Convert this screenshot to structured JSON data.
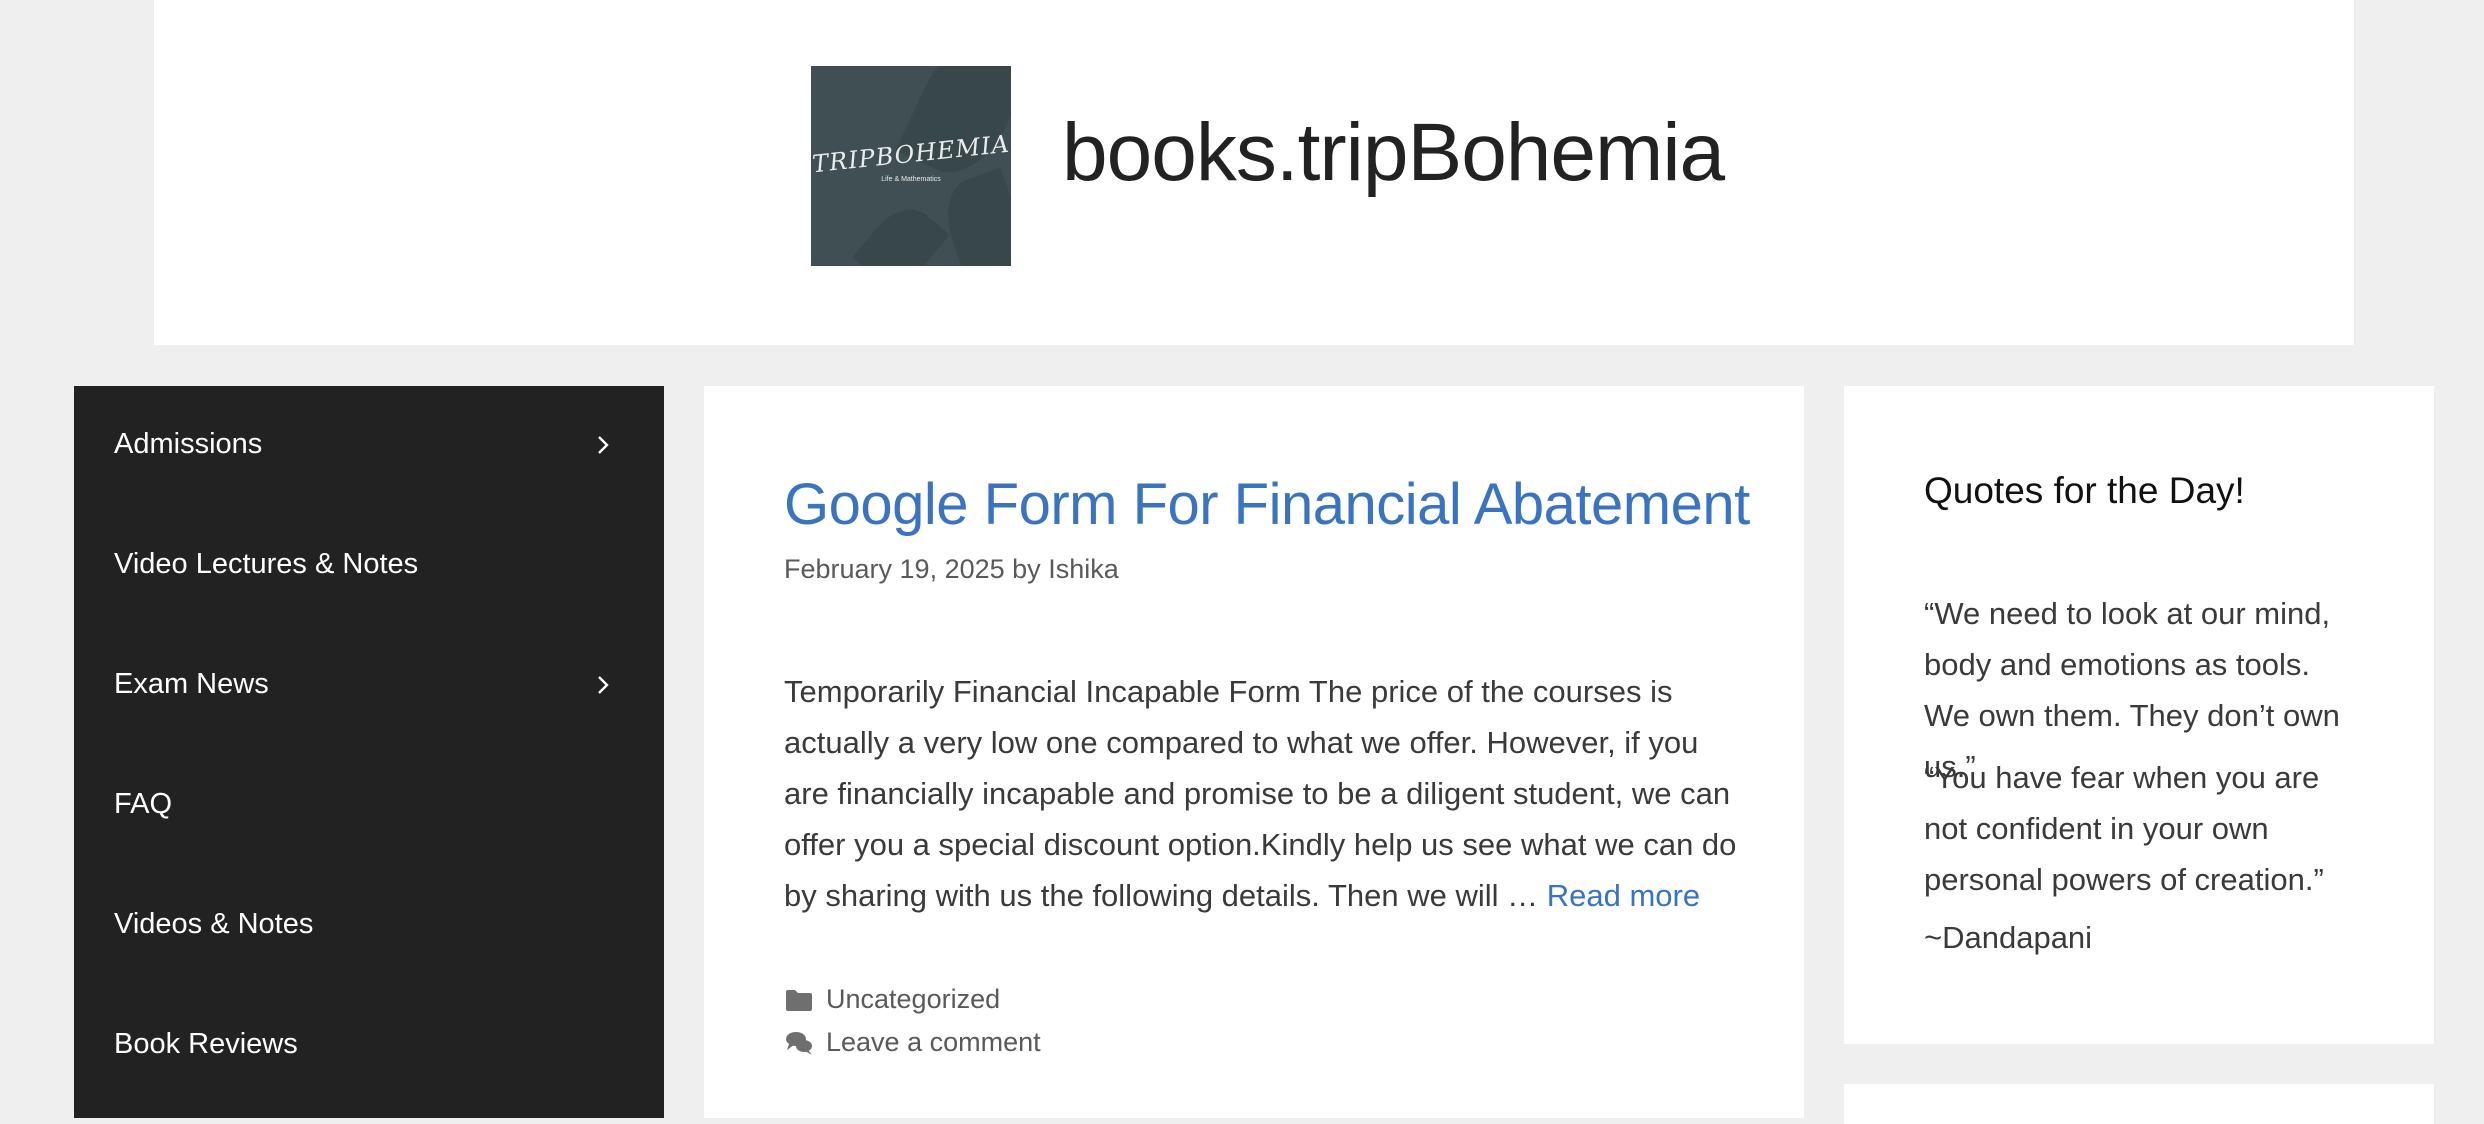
{
  "header": {
    "site_title": "books.tripBohemia",
    "logo_text": "TRIPBOHEMIA",
    "logo_tagline": "Life & Mathematics"
  },
  "nav": {
    "items": [
      {
        "label": "Admissions",
        "has_submenu": true
      },
      {
        "label": "Video Lectures & Notes",
        "has_submenu": false
      },
      {
        "label": "Exam News",
        "has_submenu": true
      },
      {
        "label": "FAQ",
        "has_submenu": false
      },
      {
        "label": "Videos & Notes",
        "has_submenu": false
      },
      {
        "label": "Book Reviews",
        "has_submenu": false
      }
    ]
  },
  "post": {
    "title": "Google Form For Financial Abatement",
    "date": "February 19, 2025",
    "by": "by",
    "author": "Ishika",
    "excerpt": "Temporarily Financial Incapable Form The price of the courses is actually a very low one compared to what we offer. However, if you are financially incapable and promise to be a diligent student, we can offer you a special discount option.Kindly help us see what we can do by sharing with us the following details. Then we will …",
    "read_more": "Read more",
    "category": "Uncategorized",
    "comment_link": "Leave a comment"
  },
  "widget": {
    "title": "Quotes for the Day!",
    "quote_1": "“We need to look at our mind, body and emotions as tools. We own them. They don’t own us.”",
    "quote_2": "“You have fear when you are not confident in your own personal powers of creation.”",
    "attribution": "~Dandapani"
  },
  "colors": {
    "background": "#efefef",
    "nav_background": "#222222",
    "link": "#3a74c0",
    "text": "#3a3a3a"
  },
  "icons": {
    "submenu": "chevron-right-icon",
    "category": "folder-icon",
    "comments": "comments-icon"
  }
}
